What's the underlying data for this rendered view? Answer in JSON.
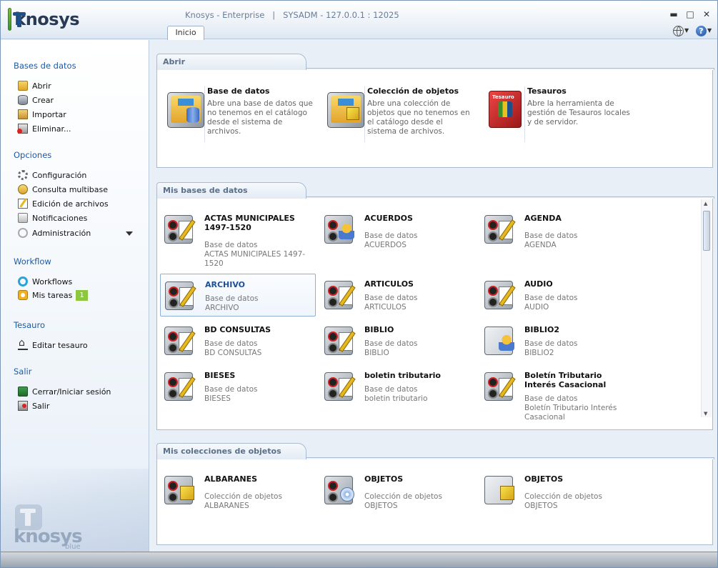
{
  "app": {
    "logo_text": "knosys",
    "window_title": "Knosys - Enterprise   |   SYSADM - 127.0.0.1 : 12025",
    "tab": "Inicio"
  },
  "sidebar": {
    "sections": [
      {
        "title": "Bases de datos",
        "items": [
          {
            "label": "Abrir",
            "icon": "folder-open-icon"
          },
          {
            "label": "Crear",
            "icon": "database-create-icon"
          },
          {
            "label": "Importar",
            "icon": "import-icon"
          },
          {
            "label": "Eliminar...",
            "icon": "delete-database-icon"
          }
        ]
      },
      {
        "title": "Opciones",
        "items": [
          {
            "label": "Configuración",
            "icon": "gear-icon"
          },
          {
            "label": "Consulta multibase",
            "icon": "multibase-icon"
          },
          {
            "label": "Edición de archivos",
            "icon": "edit-files-icon"
          },
          {
            "label": "Notificaciones",
            "icon": "notifications-icon"
          },
          {
            "label": "Administración",
            "icon": "admin-icon"
          }
        ]
      },
      {
        "title": "Workflow",
        "items": [
          {
            "label": "Workflows",
            "icon": "workflow-icon"
          },
          {
            "label": "Mis tareas",
            "icon": "tasks-icon",
            "badge": "1"
          }
        ]
      },
      {
        "title": "Tesauro",
        "items": [
          {
            "label": "Editar tesauro",
            "icon": "thesaurus-icon"
          }
        ]
      },
      {
        "title": "Salir",
        "items": [
          {
            "label": "Cerrar/Iniciar sesión",
            "icon": "session-icon"
          },
          {
            "label": "Salir",
            "icon": "exit-icon"
          }
        ]
      }
    ],
    "watermark": {
      "text": "knosys",
      "sub": "blue"
    }
  },
  "abrir": {
    "title": "Abrir",
    "items": [
      {
        "title": "Base de datos",
        "desc": "Abre una base de datos que no tenemos en el catálogo desde el sistema de archivos."
      },
      {
        "title": "Colección de objetos",
        "desc": "Abre una colección de objetos que no tenemos en el catálogo desde el sistema de archivos."
      },
      {
        "title": "Tesauros",
        "desc": "Abre la herramienta de gestión de Tesauros locales y de servidor.",
        "icon_label": "Tesauro"
      }
    ]
  },
  "bases": {
    "title": "Mis bases de datos",
    "items": [
      {
        "title": "ACTAS MUNICIPALES 1497-1520",
        "type": "Base de datos",
        "name": "ACTAS MUNICIPALES 1497-1520"
      },
      {
        "title": "ACUERDOS",
        "type": "Base de datos",
        "name": "ACUERDOS"
      },
      {
        "title": "AGENDA",
        "type": "Base de datos",
        "name": "AGENDA"
      },
      {
        "title": "ARCHIVO",
        "type": "Base de datos",
        "name": "ARCHIVO"
      },
      {
        "title": "ARTICULOS",
        "type": "Base de datos",
        "name": "ARTICULOS"
      },
      {
        "title": "AUDIO",
        "type": "Base de datos",
        "name": "AUDIO"
      },
      {
        "title": "BD CONSULTAS",
        "type": "Base de datos",
        "name": "BD CONSULTAS"
      },
      {
        "title": "BIBLIO",
        "type": "Base de datos",
        "name": "BIBLIO"
      },
      {
        "title": "BIBLIO2",
        "type": "Base de datos",
        "name": "BIBLIO2"
      },
      {
        "title": "BIESES",
        "type": "Base de datos",
        "name": "BIESES"
      },
      {
        "title": "boletin tributario",
        "type": "Base de datos",
        "name": "boletin tributario"
      },
      {
        "title": "Boletín Tributario Interés Casacional",
        "type": "Base de datos",
        "name": "Boletín Tributario Interés Casacional"
      }
    ]
  },
  "colecciones": {
    "title": "Mis colecciones de objetos",
    "items": [
      {
        "title": "ALBARANES",
        "type": "Colección de objetos",
        "name": "ALBARANES"
      },
      {
        "title": "OBJETOS",
        "type": "Colección de objetos",
        "name": "OBJETOS"
      },
      {
        "title": "OBJETOS",
        "type": "Colección de objetos",
        "name": "OBJETOS"
      }
    ]
  }
}
